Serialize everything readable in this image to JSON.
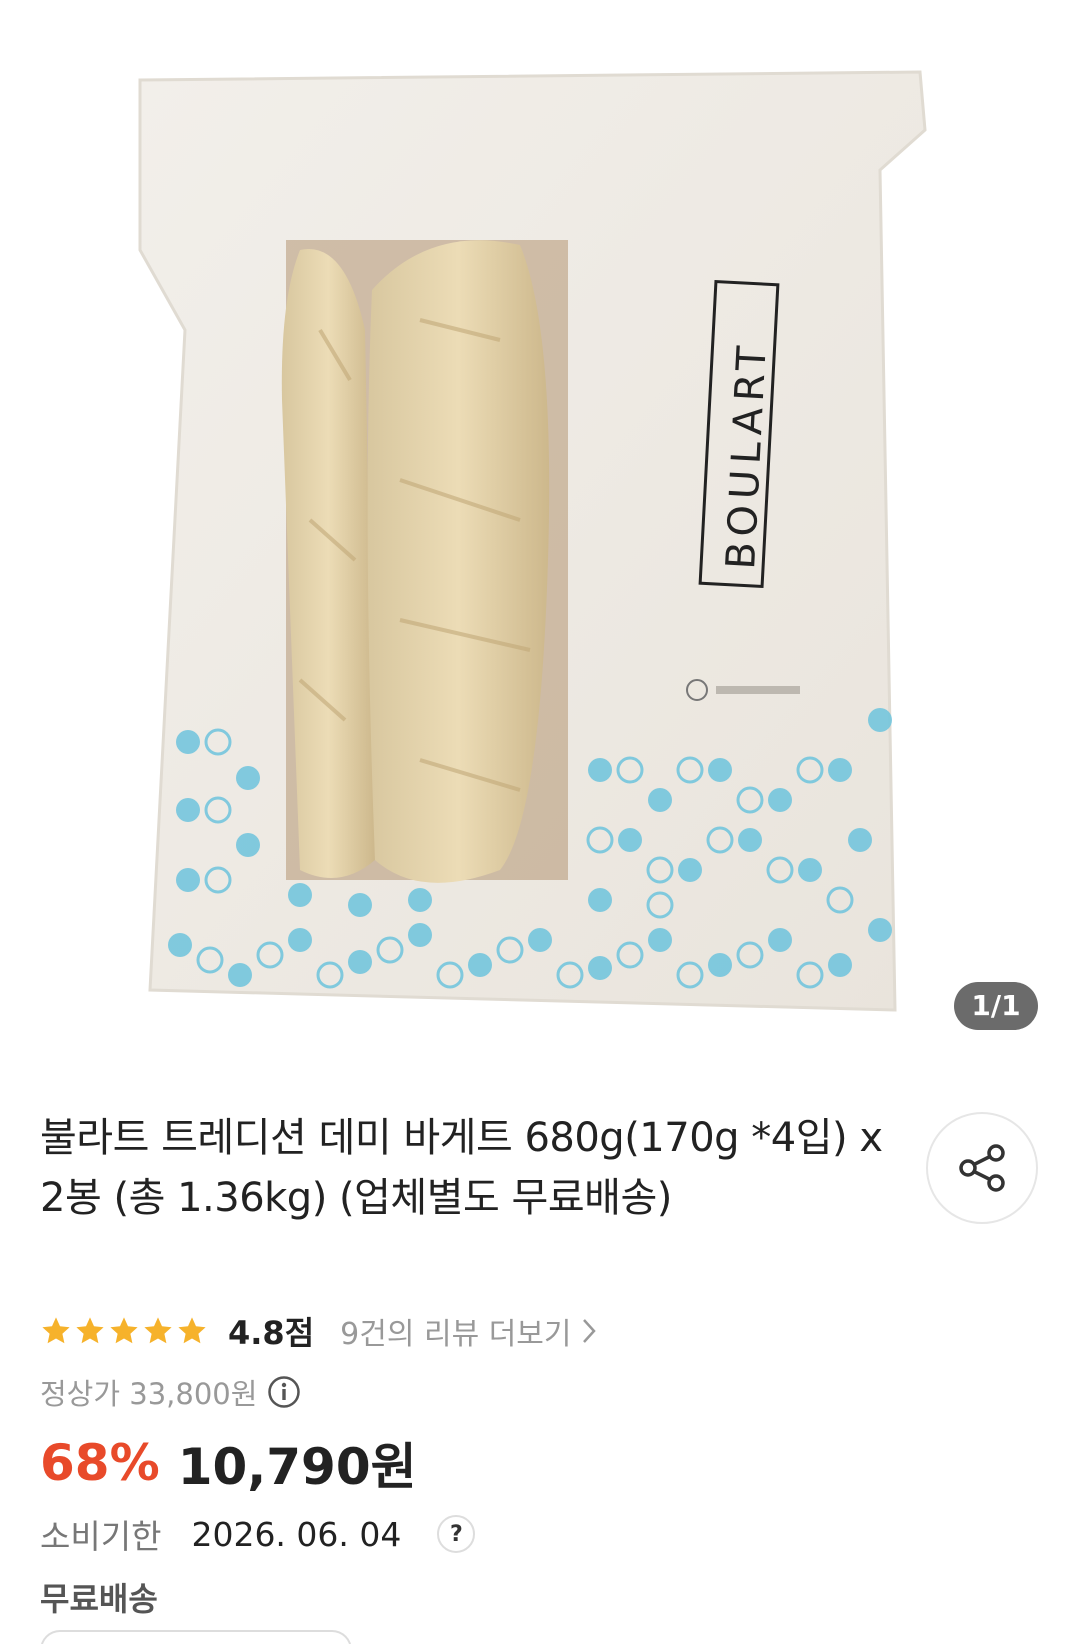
{
  "product": {
    "title": "불라트 트레디션 데미 바게트 680g(170g *4입) x 2봉 (총 1.36kg) (업체별도 무료배송)",
    "brand_logo_text": "BOULART",
    "image_counter": "1/1",
    "share_icon": "share-icon"
  },
  "rating": {
    "stars": 5,
    "value": "4.8점",
    "review_link": "9건의 리뷰 더보기",
    "star_color": "#f6b22b"
  },
  "pricing": {
    "list_price": "정상가 33,800원",
    "discount": "68%",
    "sale_price": "10,790원",
    "discount_color": "#e84a2a"
  },
  "expiry": {
    "label": "소비기한",
    "value": "2026. 06. 04",
    "help_glyph": "?"
  },
  "shipping": {
    "label": "무료배송"
  }
}
